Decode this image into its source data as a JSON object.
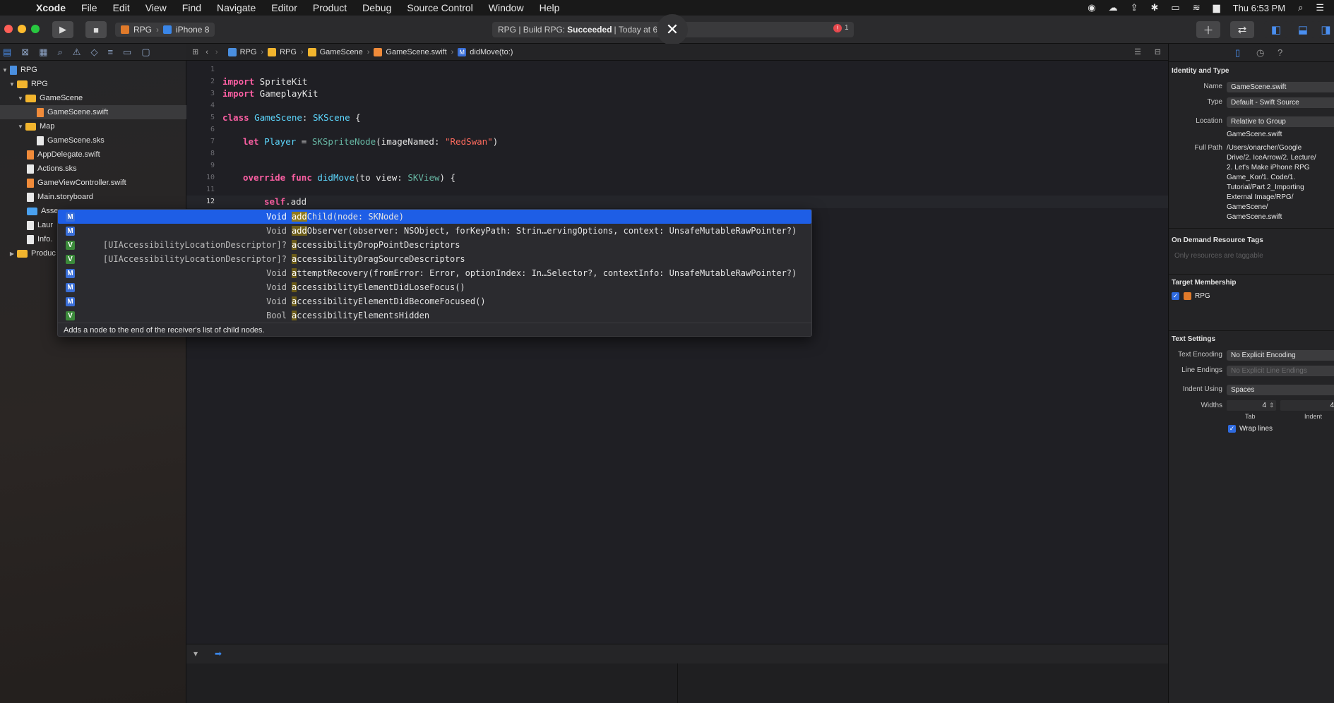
{
  "menubar": {
    "items": [
      "Xcode",
      "File",
      "Edit",
      "View",
      "Find",
      "Navigate",
      "Editor",
      "Product",
      "Debug",
      "Source Control",
      "Window",
      "Help"
    ],
    "clock": "Thu 6:53 PM"
  },
  "toolbar": {
    "scheme_target": "RPG",
    "scheme_device": "iPhone 8",
    "activity_prefix": "RPG | Build RPG:",
    "activity_status": "Succeeded",
    "activity_time": "| Today at 6:53",
    "error_count": "1"
  },
  "navigator": {
    "rows": [
      {
        "label": "RPG",
        "kind": "project",
        "level": 0
      },
      {
        "label": "RPG",
        "kind": "folder",
        "level": 1
      },
      {
        "label": "GameScene",
        "kind": "folder",
        "level": 2
      },
      {
        "label": "GameScene.swift",
        "kind": "swift",
        "level": 3,
        "selected": true
      },
      {
        "label": "Map",
        "kind": "folder",
        "level": 2
      },
      {
        "label": "GameScene.sks",
        "kind": "file",
        "level": 3
      },
      {
        "label": "AppDelegate.swift",
        "kind": "swift",
        "level": 2
      },
      {
        "label": "Actions.sks",
        "kind": "file",
        "level": 2
      },
      {
        "label": "GameViewController.swift",
        "kind": "swift",
        "level": 2
      },
      {
        "label": "Main.storyboard",
        "kind": "file",
        "level": 2
      },
      {
        "label": "Asse",
        "kind": "folder-blue",
        "level": 2
      },
      {
        "label": "Laur",
        "kind": "file",
        "level": 2
      },
      {
        "label": "Info.",
        "kind": "file",
        "level": 2
      },
      {
        "label": "Produc",
        "kind": "folder",
        "level": 1
      }
    ]
  },
  "jumpbar": {
    "crumbs": [
      "RPG",
      "RPG",
      "GameScene",
      "GameScene.swift",
      "didMove(to:)"
    ]
  },
  "editor": {
    "line_numbers": [
      "1",
      "2",
      "3",
      "4",
      "5",
      "6",
      "7",
      "8",
      "9",
      "10",
      "11",
      "12"
    ],
    "lines": {
      "l2_kw": "import",
      "l2_rest": " SpriteKit",
      "l3_kw": "import",
      "l3_rest": " GameplayKit",
      "l5_kw": "class",
      "l5_name": " GameScene",
      "l5_colon": ": ",
      "l5_super": "SKScene",
      "l5_brace": " {",
      "l7_kw": "let",
      "l7_name": " Player",
      "l7_eq": " = ",
      "l7_type": "SKSpriteNode",
      "l7_call": "(imageNamed: ",
      "l7_str": "\"RedSwan\"",
      "l7_close": ")",
      "l10_kw1": "override",
      "l10_kw2": " func",
      "l10_name": " didMove",
      "l10_args": "(to view: ",
      "l10_type": "SKView",
      "l10_close": ") {",
      "l12_self": "self",
      "l12_rest": ".add"
    }
  },
  "completion": {
    "items": [
      {
        "kind": "M",
        "type": "Void",
        "pre": "",
        "match": "add",
        "post": "Child(node: SKNode)",
        "highlight": true
      },
      {
        "kind": "M",
        "type": "Void",
        "pre": "",
        "match": "add",
        "post": "Observer(observer: NSObject, forKeyPath: Strin…ervingOptions, context: UnsafeMutableRawPointer?)"
      },
      {
        "kind": "V",
        "type": "[UIAccessibilityLocationDescriptor]?",
        "pre": "",
        "match": "a",
        "post": "ccessibilityDropPointDescriptors"
      },
      {
        "kind": "V",
        "type": "[UIAccessibilityLocationDescriptor]?",
        "pre": "",
        "match": "a",
        "post": "ccessibilityDragSourceDescriptors"
      },
      {
        "kind": "M",
        "type": "Void",
        "pre": "",
        "match": "a",
        "post": "ttemptRecovery(fromError: Error, optionIndex: In…Selector?, contextInfo: UnsafeMutableRawPointer?)"
      },
      {
        "kind": "M",
        "type": "Void",
        "pre": "",
        "match": "a",
        "post": "ccessibilityElementDidLoseFocus()"
      },
      {
        "kind": "M",
        "type": "Void",
        "pre": "",
        "match": "a",
        "post": "ccessibilityElementDidBecomeFocused()"
      },
      {
        "kind": "V",
        "type": "Bool",
        "pre": "",
        "match": "a",
        "post": "ccessibilityElementsHidden"
      }
    ],
    "description": "Adds a node to the end of the receiver's list of child nodes."
  },
  "inspector": {
    "identity_header": "Identity and Type",
    "name_label": "Name",
    "name_value": "GameScene.swift",
    "type_label": "Type",
    "type_value": "Default - Swift Source",
    "location_label": "Location",
    "location_value": "Relative to Group",
    "location_file": "GameScene.swift",
    "fullpath_label": "Full Path",
    "fullpath_lines": [
      "/Users/onarcher/Google",
      "Drive/2. IceArrow/2. Lecture/",
      "2. Let's Make iPhone RPG",
      "Game_Kor/1. Code/1.",
      "Tutorial/Part 2_Importing",
      "External Image/RPG/",
      "GameScene/",
      "GameScene.swift"
    ],
    "ondemand_header": "On Demand Resource Tags",
    "ondemand_placeholder": "Only resources are taggable",
    "target_header": "Target Membership",
    "target_name": "RPG",
    "text_header": "Text Settings",
    "encoding_label": "Text Encoding",
    "encoding_value": "No Explicit Encoding",
    "endings_label": "Line Endings",
    "endings_value": "No Explicit Line Endings",
    "indent_label": "Indent Using",
    "indent_value": "Spaces",
    "widths_label": "Widths",
    "tab_value": "4",
    "indent_width_value": "4",
    "tab_label": "Tab",
    "indent_sub_label": "Indent",
    "wrap_label": "Wrap lines"
  }
}
